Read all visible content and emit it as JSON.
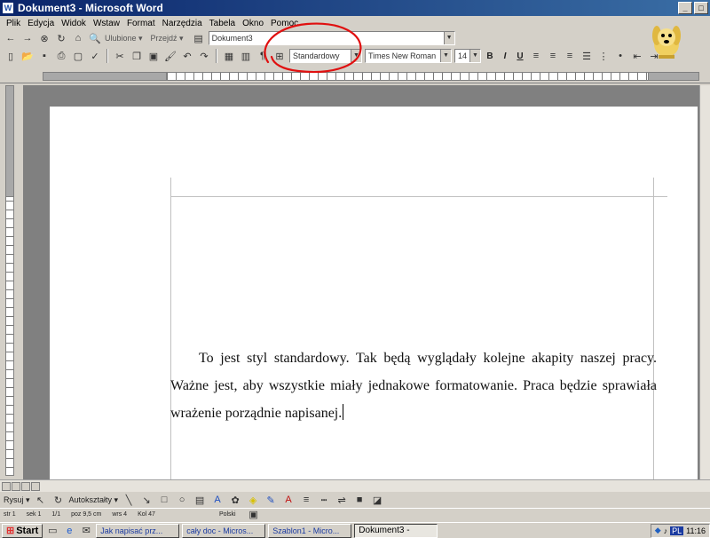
{
  "window": {
    "title": "Dokument3 - Microsoft Word",
    "controls": [
      "_",
      "□"
    ]
  },
  "menu": [
    "Plik",
    "Edycja",
    "Widok",
    "Wstaw",
    "Format",
    "Narzędzia",
    "Tabela",
    "Okno",
    "Pomoc"
  ],
  "web_toolbar": {
    "favorites": "Ulubione ▾",
    "goto": "Przejdź ▾",
    "address": "Dokument3"
  },
  "formatting": {
    "style": "Standardowy",
    "font": "Times New Roman",
    "size": "14",
    "bold": "B",
    "italic": "I",
    "underline": "U"
  },
  "document": {
    "text": "To jest styl standardowy. Tak będą wyglądały kolejne akapity naszej pracy. Ważne jest, aby wszystkie miały jednakowe formatowanie. Praca będzie sprawiała wrażenie porządnie napisanej."
  },
  "drawing": {
    "draw": "Rysuj ▾",
    "autoshapes": "Autokształty ▾"
  },
  "status": {
    "page": "str 1",
    "section": "sek 1",
    "pages": "1/1",
    "position": "poz 9,5 cm",
    "line": "wrs 4",
    "column": "Kol 47",
    "language": "Polski"
  },
  "taskbar": {
    "start": "Start",
    "tasks": [
      "Jak napisać prz...",
      "cały doc - Micros...",
      "Szablon1 - Micro...",
      "Dokument3 -"
    ],
    "clock": "11:16",
    "lang_badge": "PL"
  },
  "colors": {
    "title_start": "#0a246a",
    "title_end": "#3a6ea5",
    "annotation": "#e01010"
  }
}
